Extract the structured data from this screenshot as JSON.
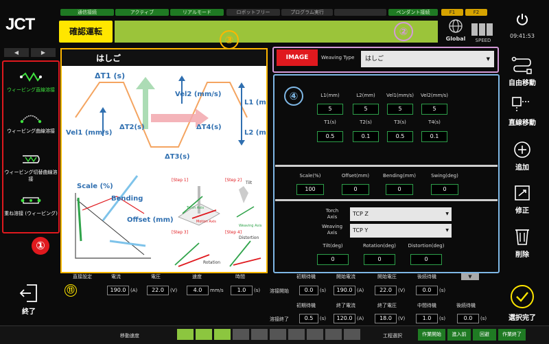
{
  "brand": {
    "logo": "JCT"
  },
  "status_bar": [
    {
      "label": "通信接続",
      "on": true
    },
    {
      "label": "アクティブ",
      "on": true
    },
    {
      "label": "リアルモード",
      "on": true
    },
    {
      "label": "ロボットフリー",
      "on": false
    },
    {
      "label": "プログラム実行",
      "on": false
    },
    {
      "label": "",
      "on": false
    },
    {
      "label": "ペンダント接続",
      "on": true
    }
  ],
  "f_keys": [
    "F1",
    "F2"
  ],
  "header": {
    "mode": "確認運転",
    "global_label": "Global",
    "speed_label": "SPEED",
    "time": "09:41:53"
  },
  "right_panel": {
    "auto_move": "自由移動",
    "linear_move": "直線移動",
    "add": "追加",
    "modify": "修正",
    "delete": "削除",
    "select_done": "選択完了"
  },
  "left_panel": {
    "items": [
      {
        "label": "ウィービング直線溶接",
        "active": true
      },
      {
        "label": "ウィービング曲線溶接",
        "active": false
      },
      {
        "label": "ウィービング切替曲線溶接",
        "active": false
      },
      {
        "label": "重ね溶接 (ウィービング)",
        "active": false
      }
    ],
    "exit_label": "終了"
  },
  "image_panel": {
    "title": "はしご",
    "diagram_labels": [
      "ΔT1 (s)",
      "Vel2 (mm/s)",
      "L1 (mm)",
      "Vel1 (mm/s)",
      "ΔT2(s)",
      "ΔT4(s)",
      "L2 (mm)",
      "ΔT3(s)",
      "Scale (%)",
      "Bending",
      "Offset (mm)",
      "[Step 1]",
      "[Step 2]",
      "[Step 3]",
      "[Step 4]",
      "Torch Axis",
      "Weaving Axis",
      "Motion Axis",
      "Tilt",
      "Rotation",
      "Distortion"
    ]
  },
  "weaving": {
    "image_button": "IMAGE",
    "type_label": "Weaving Type",
    "type_value": "はしご"
  },
  "params": {
    "row1_labels": [
      "L1(mm)",
      "L2(mm)",
      "Vel1(mm/s)",
      "Vel2(mm/s)"
    ],
    "row1_values": [
      "5",
      "5",
      "5",
      "5"
    ],
    "row2_labels": [
      "T1(s)",
      "T2(s)",
      "T3(s)",
      "T4(s)"
    ],
    "row2_values": [
      "0.5",
      "0.1",
      "0.5",
      "0.1"
    ],
    "row3_labels": [
      "Scale(%)",
      "Offset(mm)",
      "Bending(mm)",
      "Swing(deg)"
    ],
    "row3_values": [
      "100",
      "0",
      "0",
      "0"
    ],
    "torch_axis_label": "Torch\nAxis",
    "torch_axis_value": "TCP Z",
    "weaving_axis_label": "Weaving\nAxis",
    "weaving_axis_value": "TCP Y",
    "row4_labels": [
      "Tilt(deg)",
      "Rotation(deg)",
      "Distortion(deg)"
    ],
    "row4_values": [
      "0",
      "0",
      "0"
    ]
  },
  "callouts": [
    "①",
    "②",
    "③",
    "④",
    "⑪"
  ],
  "weld": {
    "head": [
      "直接設定",
      "電流",
      "電圧",
      "速度",
      "時間"
    ],
    "direct": {
      "current": "190.0",
      "voltage": "22.0",
      "speed": "4.0",
      "time": "1.0"
    },
    "units": {
      "a": "(A)",
      "v": "(V)",
      "mms": "mm/s",
      "s": "(s)"
    },
    "start_head": [
      "初期待機",
      "開始電流",
      "開始電圧",
      "後続待機"
    ],
    "start_label": "溶接開始",
    "start": {
      "wait1": "0.0",
      "current": "190.0",
      "voltage": "22.0",
      "wait2": "0.0"
    },
    "end_head": [
      "初期待機",
      "終了電流",
      "終了電圧",
      "中間待機",
      "後続待機"
    ],
    "end_label": "溶接終了",
    "end": {
      "wait1": "0.5",
      "current": "120.0",
      "voltage": "18.0",
      "mid": "1.0",
      "wait2": "0.0"
    }
  },
  "footer": {
    "move_speed_label": "移動速度",
    "speed_level": 3,
    "speed_segments": 10,
    "process_label": "工程選択",
    "buttons": [
      "作業開始",
      "進入前",
      "回避",
      "作業終了"
    ]
  },
  "colors": {
    "accent_green": "#1f7a23",
    "mode_yellow": "#ffe600",
    "alert_red": "#e0191e",
    "frame_orange": "#ffb600",
    "frame_blue": "#7fb8e6",
    "frame_pink": "#d49ad8"
  }
}
